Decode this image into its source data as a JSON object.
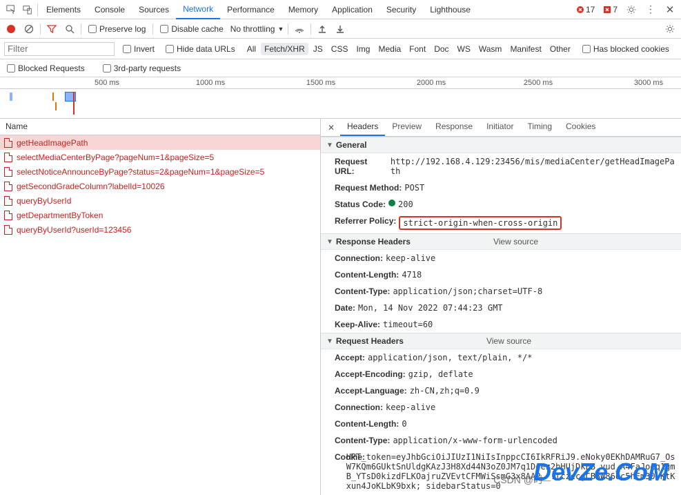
{
  "topbar": {
    "tabs": [
      "Elements",
      "Console",
      "Sources",
      "Network",
      "Performance",
      "Memory",
      "Application",
      "Security",
      "Lighthouse"
    ],
    "active_tab": "Network",
    "errors_count": "17",
    "issues_count": "7"
  },
  "toolbar2": {
    "preserve_log": "Preserve log",
    "disable_cache": "Disable cache",
    "throttling": "No throttling"
  },
  "filterbar": {
    "filter_placeholder": "Filter",
    "invert": "Invert",
    "hide_data_urls": "Hide data URLs",
    "types": [
      "All",
      "Fetch/XHR",
      "JS",
      "CSS",
      "Img",
      "Media",
      "Font",
      "Doc",
      "WS",
      "Wasm",
      "Manifest",
      "Other"
    ],
    "active_type": "Fetch/XHR",
    "has_blocked": "Has blocked cookies"
  },
  "reqbar": {
    "blocked": "Blocked Requests",
    "thirdparty": "3rd-party requests"
  },
  "timeline": {
    "ticks": [
      "500 ms",
      "1000 ms",
      "1500 ms",
      "2000 ms",
      "2500 ms",
      "3000 ms"
    ]
  },
  "name_header": "Name",
  "requests": [
    {
      "name": "getHeadImagePath",
      "sel": true
    },
    {
      "name": "selectMediaCenterByPage?pageNum=1&pageSize=5"
    },
    {
      "name": "selectNoticeAnnounceByPage?status=2&pageNum=1&pageSize=5"
    },
    {
      "name": "getSecondGradeColumn?labelId=10026"
    },
    {
      "name": "queryByUserId"
    },
    {
      "name": "getDepartmentByToken"
    },
    {
      "name": "queryByUserId?userId=123456"
    }
  ],
  "details": {
    "tabs": [
      "Headers",
      "Preview",
      "Response",
      "Initiator",
      "Timing",
      "Cookies"
    ],
    "active": "Headers",
    "general": {
      "title": "General",
      "items": [
        {
          "k": "Request URL:",
          "v": "http://192.168.4.129:23456/mis/mediaCenter/getHeadImagePath"
        },
        {
          "k": "Request Method:",
          "v": "POST"
        },
        {
          "k": "Status Code:",
          "v": "200",
          "status": true
        },
        {
          "k": "Referrer Policy:",
          "v": "strict-origin-when-cross-origin",
          "highlight": true
        }
      ]
    },
    "response_headers": {
      "title": "Response Headers",
      "viewsrc": "View source",
      "items": [
        {
          "k": "Connection:",
          "v": "keep-alive"
        },
        {
          "k": "Content-Length:",
          "v": "4718"
        },
        {
          "k": "Content-Type:",
          "v": "application/json;charset=UTF-8"
        },
        {
          "k": "Date:",
          "v": "Mon, 14 Nov 2022 07:44:23 GMT"
        },
        {
          "k": "Keep-Alive:",
          "v": "timeout=60"
        }
      ]
    },
    "request_headers": {
      "title": "Request Headers",
      "viewsrc": "View source",
      "items": [
        {
          "k": "Accept:",
          "v": "application/json, text/plain, */*"
        },
        {
          "k": "Accept-Encoding:",
          "v": "gzip, deflate"
        },
        {
          "k": "Accept-Language:",
          "v": "zh-CN,zh;q=0.9"
        },
        {
          "k": "Connection:",
          "v": "keep-alive"
        },
        {
          "k": "Content-Length:",
          "v": "0"
        },
        {
          "k": "Content-Type:",
          "v": "application/x-www-form-urlencoded"
        },
        {
          "k": "Cookie:",
          "v": "HPT_token=eyJhbGciOiJIUzI1NiIsInppcCI6IkRFRiJ9.eNoky0EKhDAMRuG7_OsW7KQm6GUktSnUldgKAzJ3H8Xd44N3oZ0JM7q1Doez2bHUjDkEB_vud_A4FaJoeq1gmB_YTsD0kizdFLKOajruZVEvtCFMWiSsmG3x8AAP__.tczccgCB8W86oc5hFm30-KtKxun4JoKLbK9bxk; sidebarStatus=0"
        }
      ]
    }
  },
  "watermark": "DevZe.CoM",
  "watermark2": "CSDN @时"
}
